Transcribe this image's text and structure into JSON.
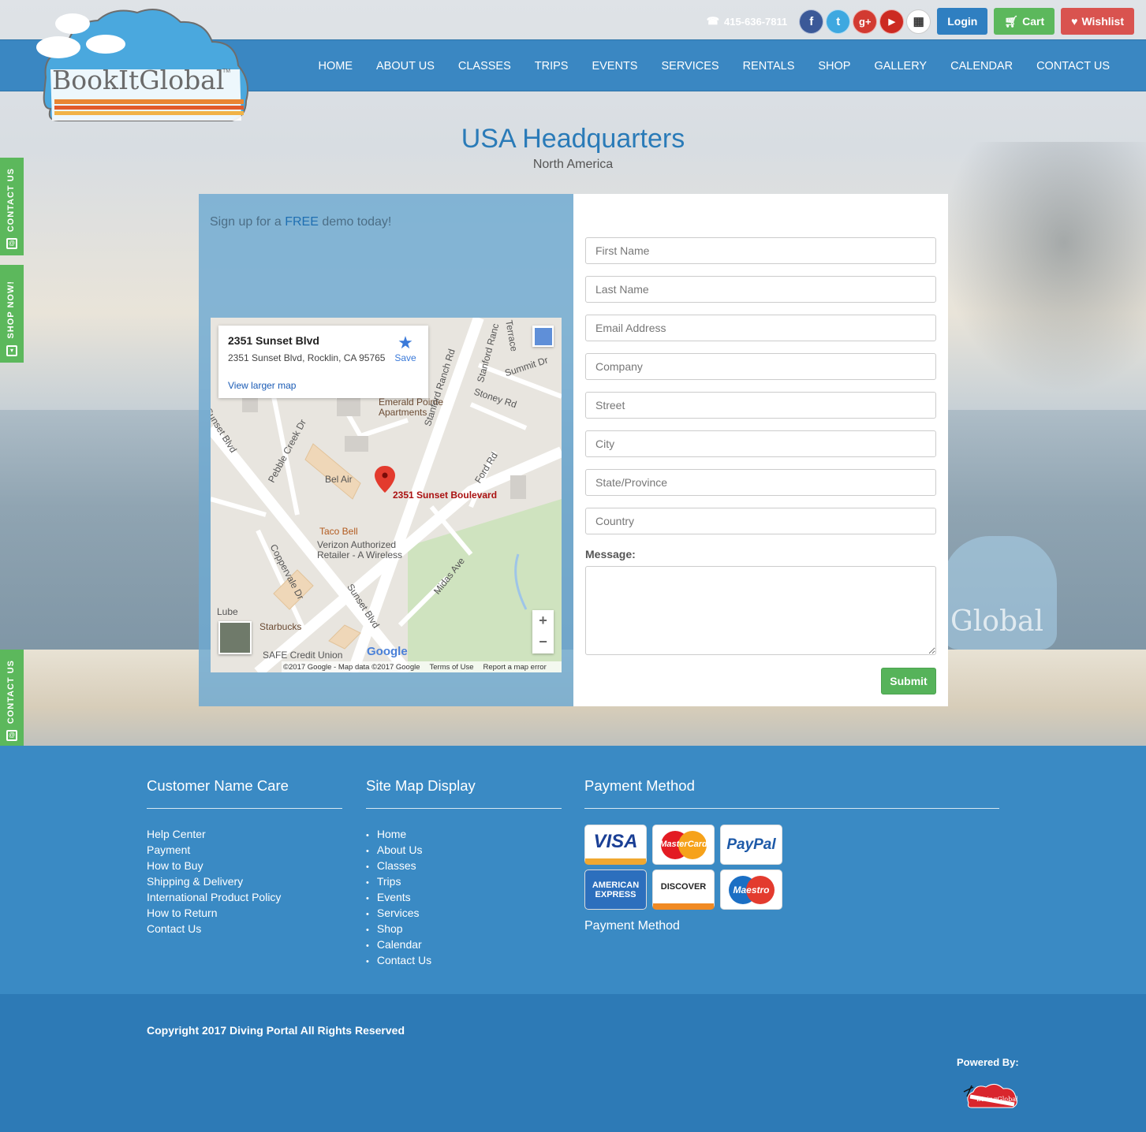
{
  "brand": {
    "logo_text": "BookItGlobal",
    "tm": "TM"
  },
  "topbar": {
    "phone": "415-636-7811",
    "social": [
      {
        "name": "facebook-icon",
        "glyph": "f",
        "color": "#3b5998"
      },
      {
        "name": "twitter-icon",
        "glyph": "t",
        "color": "#3ea8e0"
      },
      {
        "name": "google-plus-icon",
        "glyph": "g+",
        "color": "#d23a31"
      },
      {
        "name": "youtube-icon",
        "glyph": "▶",
        "color": "#cc2a22"
      },
      {
        "name": "shop-icon",
        "glyph": "▦",
        "color": "#ffffff"
      }
    ],
    "login_label": "Login",
    "cart_label": "Cart",
    "wishlist_label": "Wishlist"
  },
  "colors": {
    "nav": "#3a87c2",
    "login": "#2f7fc1",
    "cart": "#5cb85c",
    "wishlist": "#d9534f"
  },
  "nav": {
    "items": [
      {
        "label": "HOME"
      },
      {
        "label": "ABOUT US"
      },
      {
        "label": "CLASSES"
      },
      {
        "label": "TRIPS"
      },
      {
        "label": "EVENTS"
      },
      {
        "label": "SERVICES"
      },
      {
        "label": "RENTALS"
      },
      {
        "label": "SHOP"
      },
      {
        "label": "GALLERY"
      },
      {
        "label": "CALENDAR"
      },
      {
        "label": "CONTACT US"
      }
    ]
  },
  "page": {
    "title": "USA Headquarters",
    "subtitle": "North America"
  },
  "signup": {
    "prefix": "Sign up for a",
    "free": "FREE",
    "suffix": "demo today!"
  },
  "map": {
    "card_title": "2351 Sunset Blvd",
    "card_address": "2351 Sunset Blvd, Rocklin, CA 95765",
    "save_label": "Save",
    "larger_map": "View larger map",
    "pin_label": "2351 Sunset Boulevard",
    "labels": {
      "emerald": "Emerald Pointe",
      "emerald2": "Apartments",
      "belair": "Bel Air",
      "tacobell": "Taco Bell",
      "verizon": "Verizon Authorized",
      "verizon2": "Retailer - A Wireless",
      "lube": "Lube",
      "starbucks": "Starbucks",
      "credit": "SAFE Credit Union",
      "stanford": "Stanford Ranch Rd",
      "stoney": "Stoney Rd",
      "summit": "Summit Dr",
      "pebble": "Pebble Creek Dr",
      "ford": "Ford Rd",
      "midas": "Midas Ave",
      "coppervale": "Coppervale Dr",
      "sunset": "Sunset Blvd",
      "sunset2": "Sunset Blvd",
      "terrace": "Terrace",
      "stanford2": "Stanford Ranc"
    },
    "google": "Google",
    "zoom_in": "+",
    "zoom_out": "−",
    "footer_data": "©2017 Google - Map data ©2017 Google",
    "footer_terms": "Terms of Use",
    "footer_report": "Report a map error"
  },
  "form": {
    "first_name": "First Name",
    "last_name": "Last Name",
    "email": "Email Address",
    "company": "Company",
    "street": "Street",
    "city": "City",
    "state": "State/Province",
    "country": "Country",
    "message_label": "Message:",
    "submit_label": "Submit"
  },
  "sidetabs": {
    "contact": "CONTACT US",
    "shop": "SHOP NOW!"
  },
  "footer": {
    "col1": {
      "title": "Customer Name Care",
      "links": [
        "Help Center",
        "Payment",
        "How to Buy",
        "Shipping & Delivery",
        "International Product Policy",
        "How to Return",
        "Contact Us"
      ]
    },
    "col2": {
      "title": "Site Map Display",
      "links": [
        "Home",
        "About Us",
        "Classes",
        "Trips",
        "Events",
        "Services",
        "Shop",
        "Calendar",
        "Contact Us"
      ]
    },
    "col3": {
      "title": "Payment Method",
      "cards": [
        "VISA",
        "MasterCard",
        "PayPal",
        "AMERICAN EXPRESS",
        "DISCOVER",
        "Maestro"
      ],
      "label": "Payment Method"
    },
    "copyright": "Copyright 2017 Diving Portal All Rights Reserved",
    "powered_by": "Powered By:",
    "powered_logo": "DivingGlobal"
  },
  "background_watermark": "Global"
}
